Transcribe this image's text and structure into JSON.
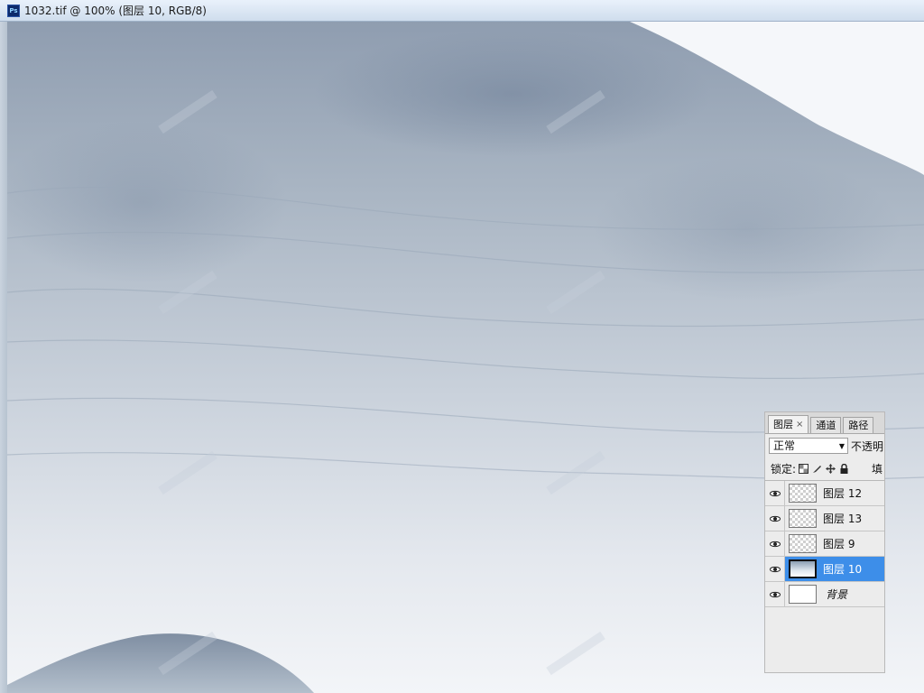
{
  "window": {
    "title": "1032.tif @ 100% (图层 10, RGB/8)",
    "app_icon": "photoshop-document-icon",
    "app_icon_text": "Ps"
  },
  "layers_panel": {
    "tabs": [
      {
        "label": "图层",
        "active": true,
        "closable": true,
        "close_glyph": "×"
      },
      {
        "label": "通道",
        "active": false
      },
      {
        "label": "路径",
        "active": false
      }
    ],
    "blend_mode": "正常",
    "opacity_label": "不透明",
    "lock_label": "锁定:",
    "fill_label": "填",
    "lock_icons": [
      "lock-transparent-icon",
      "lock-paint-icon",
      "lock-move-icon",
      "lock-all-icon"
    ],
    "layers": [
      {
        "name": "图层 12",
        "visible": true,
        "selected": false,
        "thumb": "transparent"
      },
      {
        "name": "图层 13",
        "visible": true,
        "selected": false,
        "thumb": "transparent"
      },
      {
        "name": "图层 9",
        "visible": true,
        "selected": false,
        "thumb": "transparent"
      },
      {
        "name": "图层 10",
        "visible": true,
        "selected": true,
        "thumb": "image"
      },
      {
        "name": "背景",
        "visible": true,
        "selected": false,
        "thumb": "white",
        "italic": true
      }
    ]
  },
  "canvas": {
    "content": "ink-wash-mountain-texture",
    "colors": {
      "dark": "#8e9db0",
      "mid": "#b8c3cf",
      "light": "#eef1f5"
    }
  }
}
